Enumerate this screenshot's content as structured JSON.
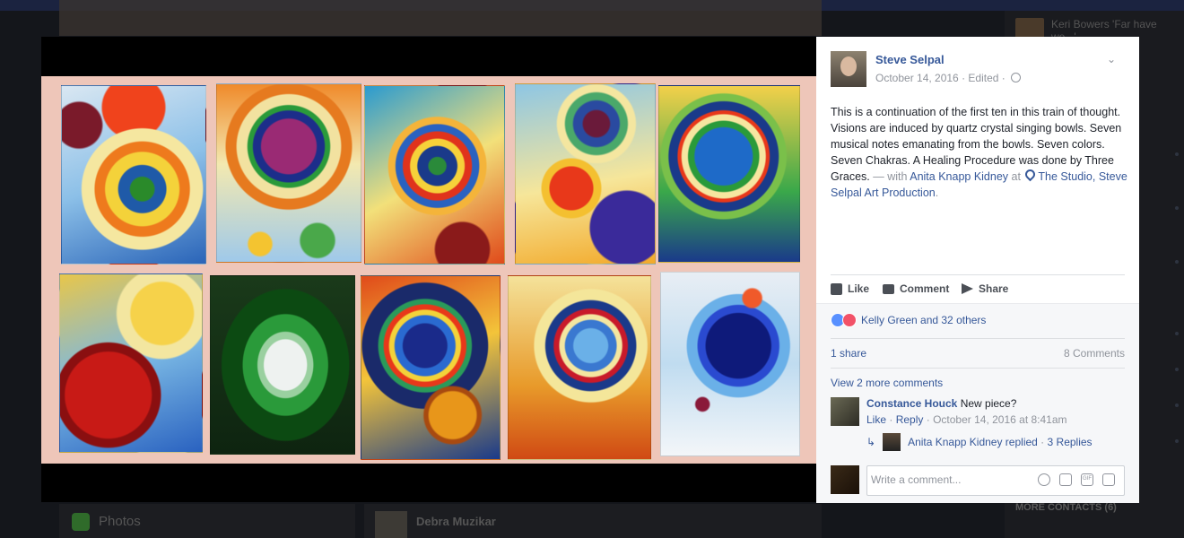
{
  "background": {
    "chat_contact_name": "Keri Bowers 'Far have we...'",
    "contacts_heading": "MORE CONTACTS (6)",
    "photos_label": "Photos",
    "person_name": "Debra Muzikar"
  },
  "post": {
    "author": "Steve Selpal",
    "date": "October 14, 2016",
    "edited": "Edited",
    "text_main": "This is a continuation of the first ten in this train of thought.\nVisions are induced by quartz crystal singing bowls. Seven musical notes emanating from the bowls. Seven colors. Seven Chakras. A Healing Procedure was done by Three Graces.",
    "with_prefix": " — with ",
    "tagged_person": "Anita Knapp Kidney",
    "at_word": " at ",
    "place": "The Studio, Steve Selpal Art Production",
    "period": "."
  },
  "actions": {
    "like": "Like",
    "comment": "Comment",
    "share": "Share"
  },
  "feedback": {
    "reactions_text": "Kelly Green and 32 others",
    "shares_text": "1 share",
    "comments_count": "8 Comments",
    "view_more": "View 2 more comments"
  },
  "comment": {
    "author": "Constance Houck",
    "text": "New piece?",
    "like": "Like",
    "reply": "Reply",
    "timestamp": "October 14, 2016 at 8:41am",
    "reply_summary": "Anita Knapp Kidney replied",
    "replies_count": "3 Replies"
  },
  "composer": {
    "placeholder": "Write a comment..."
  },
  "colors": {
    "link": "#365899",
    "muted": "#90949c",
    "panel_bg": "#ffffff",
    "feedback_bg": "#f6f7f9"
  },
  "icons": [
    "chevron-down-icon",
    "globe-icon",
    "pin-icon",
    "like-icon",
    "comment-icon",
    "share-icon",
    "like-reaction-icon",
    "love-reaction-icon",
    "reply-arrow-icon",
    "emoji-icon",
    "camera-icon",
    "gif-icon",
    "sticker-icon"
  ]
}
